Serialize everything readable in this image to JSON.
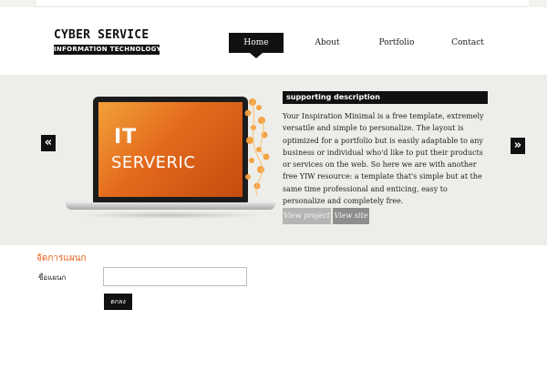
{
  "header": {
    "logo_top": "CYBER SERVICE",
    "logo_bottom": "INFORMATION TECHNOLOGY"
  },
  "nav": {
    "items": [
      {
        "label": "Home",
        "active": true
      },
      {
        "label": "About"
      },
      {
        "label": "Portfolio"
      },
      {
        "label": "Contact"
      }
    ]
  },
  "slider": {
    "prev_icon": "double-chevron-left",
    "next_icon": "double-chevron-right",
    "screen_line1": "IT",
    "screen_line2": "SERVERIC",
    "desc_title": "supporting description",
    "desc_body": "Your Inspiration Minimal is a free template, extremely versatile and simple to personalize. The layout is optimized for a portfolio but is easily adaptable to any business or individual who'd like to put their products or services on the web. So here we are with another free YIW resource: a template that's simple but at the same time professional and enticing, easy to personalize and completely free.",
    "btn_project": "View project",
    "btn_site": "View site"
  },
  "form": {
    "title": "จัดการแผนก",
    "field_label": "ชื่อแผนก",
    "field_value": "",
    "submit_label": "ตกลง"
  },
  "colors": {
    "accent": "#e8601a",
    "dark": "#111111",
    "band": "#edeeea"
  }
}
